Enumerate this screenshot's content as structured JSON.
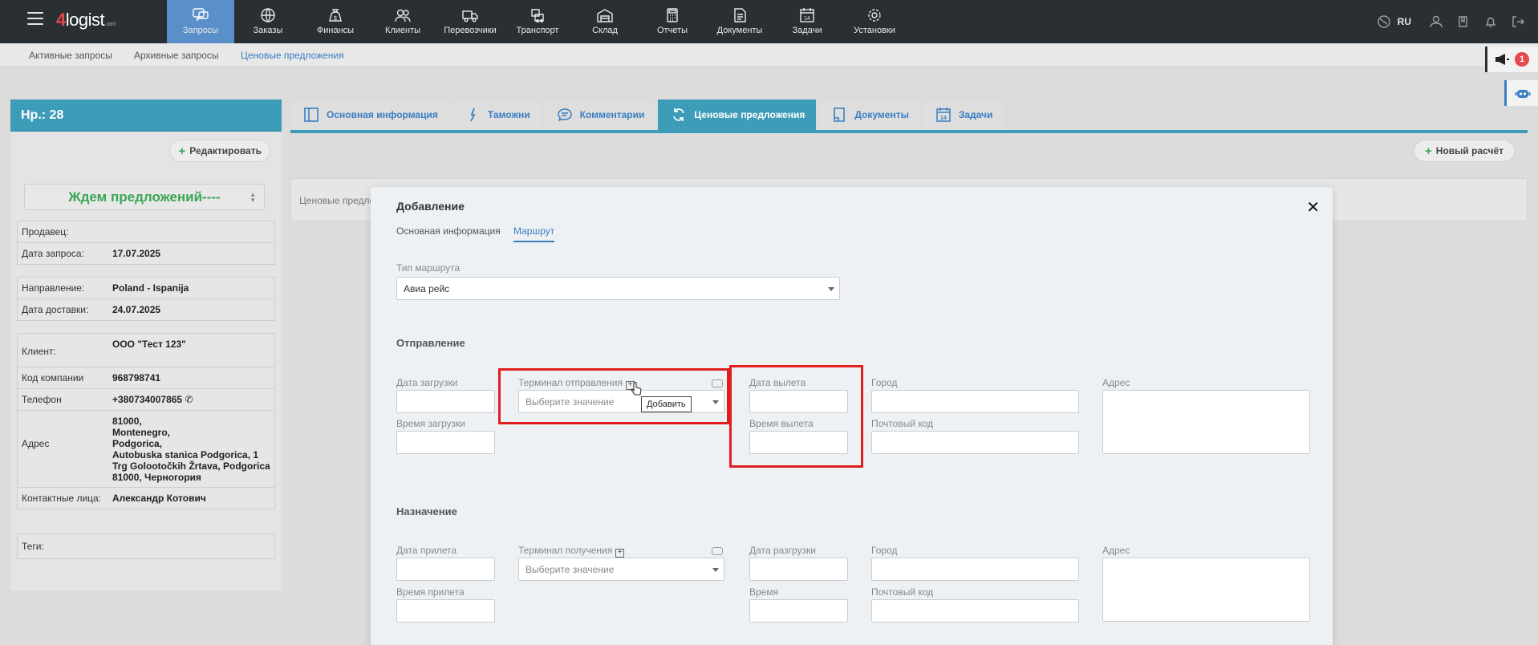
{
  "app": {
    "logo_main": "logist",
    "logo_digit": "4",
    "logo_suffix": ".com"
  },
  "nav": [
    {
      "label": "Запросы",
      "icon": "chat-icon",
      "active": true
    },
    {
      "label": "Заказы",
      "icon": "globe-icon"
    },
    {
      "label": "Финансы",
      "icon": "money-bag-icon"
    },
    {
      "label": "Клиенты",
      "icon": "users-icon"
    },
    {
      "label": "Перевозчики",
      "icon": "truck-icon"
    },
    {
      "label": "Транспорт",
      "icon": "vehicles-icon"
    },
    {
      "label": "Склад",
      "icon": "warehouse-icon"
    },
    {
      "label": "Отчеты",
      "icon": "calculator-icon"
    },
    {
      "label": "Документы",
      "icon": "document-icon"
    },
    {
      "label": "Задачи",
      "icon": "calendar-icon"
    },
    {
      "label": "Установки",
      "icon": "gear-icon"
    }
  ],
  "topright": {
    "lang": "RU"
  },
  "subnav": {
    "active_requests": "Активные запросы",
    "archive_requests": "Архивные запросы",
    "price_offers": "Ценовые предложения"
  },
  "notifications": {
    "count": "1"
  },
  "request": {
    "number": "Нр.: 28",
    "edit_label": "Редактировать",
    "status": "Ждем предложений----",
    "seller_label": "Продавец:",
    "seller_value": "",
    "request_date_label": "Дата запроса:",
    "request_date": "17.07.2025",
    "direction_label": "Направление:",
    "direction": "Poland - Ispanija",
    "delivery_date_label": "Дата доставки:",
    "delivery_date": "24.07.2025",
    "client_label": "Клиент:",
    "client": "ООО \"Тест 123\"",
    "company_code_label": "Код компании",
    "company_code": "968798741",
    "phone_label": "Телефон",
    "phone": "+380734007865",
    "address_label": "Адрес",
    "address_lines": [
      "81000,",
      "Montenegro,",
      "Podgorica,",
      "Autobuska stanica Podgorica, 1",
      "Trg Golootočkih Žrtava, Podgorica",
      "81000, Черногория"
    ],
    "contacts_label": "Контактные лица:",
    "contacts": "Александр Котович",
    "tags_label": "Теги:"
  },
  "tabs": [
    {
      "label": "Основная информация",
      "icon": "layout-icon"
    },
    {
      "label": "Таможни",
      "icon": "customs-icon"
    },
    {
      "label": "Комментарии",
      "icon": "comment-icon"
    },
    {
      "label": "Ценовые предложения",
      "icon": "refresh-icon",
      "active": true
    },
    {
      "label": "Документы",
      "icon": "document-icon"
    },
    {
      "label": "Задачи",
      "icon": "calendar-icon"
    }
  ],
  "offers": {
    "new_calc_label": "Новый расчёт",
    "strip_text": "Ценовые предло"
  },
  "modal": {
    "title": "Добавление",
    "tab_main": "Основная информация",
    "tab_route": "Маршрут",
    "route_type_label": "Тип маршрута",
    "route_type_value": "Авиа рейс",
    "departure": {
      "section": "Отправление",
      "load_date": "Дата загрузки",
      "load_time": "Время загрузки",
      "terminal": "Терминал отправления",
      "terminal_placeholder": "Выберите значение",
      "flight_date": "Дата вылета",
      "flight_time": "Время вылета",
      "city": "Город",
      "postal": "Почтовый код",
      "address": "Адрес"
    },
    "destination": {
      "section": "Назначение",
      "arrival_date": "Дата прилета",
      "arrival_time": "Время прилета",
      "terminal": "Терминал получения",
      "terminal_placeholder": "Выберите значение",
      "unload_date": "Дата разгрузки",
      "time": "Время",
      "city": "Город",
      "postal": "Почтовый код",
      "address": "Адрес"
    },
    "tooltip": "Добавить"
  },
  "colors": {
    "accent": "#3d9cb7",
    "nav_active": "#5b8fc9",
    "status_green": "#3aa556",
    "highlight_red": "#e01e1e"
  }
}
